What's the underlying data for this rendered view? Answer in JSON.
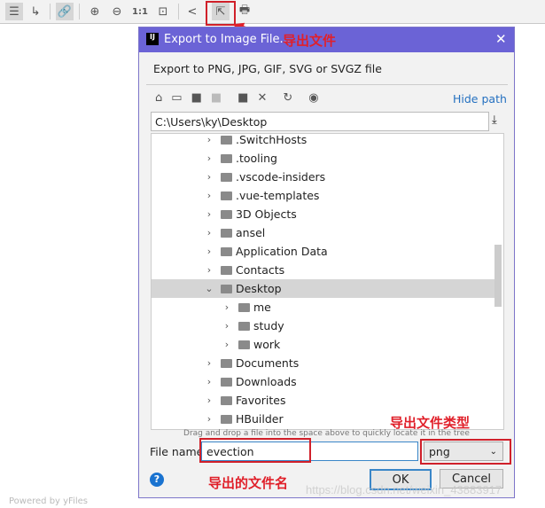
{
  "toolbar": {
    "items": [
      "settings-icon",
      "edge-route-icon",
      "link-icon",
      "zoom-in-icon",
      "zoom-out-icon",
      "1:1",
      "fit-icon",
      "hierarchy-icon",
      "export-icon",
      "print-icon"
    ],
    "actual_size_label": "1:1"
  },
  "annotations": {
    "export_file": "导出文件",
    "file_type": "导出文件类型",
    "file_name": "导出的文件名",
    "accent": "#e0202a"
  },
  "dialog": {
    "title": "Export to Image File...",
    "subtitle": "Export to PNG, JPG, GIF, SVG or SVGZ file",
    "hide_path": "Hide path",
    "path": "C:\\Users\\ky\\Desktop",
    "tree": [
      {
        "label": ".SwitchHosts",
        "level": 0,
        "expanded": false
      },
      {
        "label": ".tooling",
        "level": 0,
        "expanded": false
      },
      {
        "label": ".vscode-insiders",
        "level": 0,
        "expanded": false
      },
      {
        "label": ".vue-templates",
        "level": 0,
        "expanded": false
      },
      {
        "label": "3D Objects",
        "level": 0,
        "expanded": false
      },
      {
        "label": "ansel",
        "level": 0,
        "expanded": false
      },
      {
        "label": "Application Data",
        "level": 0,
        "expanded": false
      },
      {
        "label": "Contacts",
        "level": 0,
        "expanded": false
      },
      {
        "label": "Desktop",
        "level": 0,
        "expanded": true,
        "selected": true
      },
      {
        "label": "me",
        "level": 1,
        "expanded": false
      },
      {
        "label": "study",
        "level": 1,
        "expanded": false
      },
      {
        "label": "work",
        "level": 1,
        "expanded": false
      },
      {
        "label": "Documents",
        "level": 0,
        "expanded": false
      },
      {
        "label": "Downloads",
        "level": 0,
        "expanded": false
      },
      {
        "label": "Favorites",
        "level": 0,
        "expanded": false
      },
      {
        "label": "HBuilder",
        "level": 0,
        "expanded": false
      }
    ],
    "drag_hint": "Drag and drop a file into the space above to quickly locate it in the tree",
    "file_name_label": "File name:",
    "file_name": "evection",
    "file_type": "png",
    "ok": "OK",
    "cancel": "Cancel",
    "title_color": "#6b63d6"
  },
  "watermark": "https://blog.csdn.net/weixin_43883917",
  "footer": "Powered by yFiles"
}
